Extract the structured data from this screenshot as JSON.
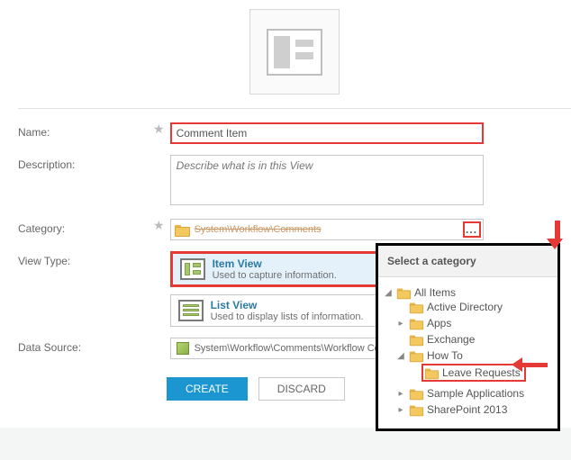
{
  "labels": {
    "name": "Name:",
    "description": "Description:",
    "category": "Category:",
    "viewtype": "View Type:",
    "datasource": "Data Source:"
  },
  "name_value": "Comment Item",
  "description_placeholder": "Describe what is in this View",
  "category_value": "System\\Workflow\\Comments",
  "ellipsis": "...",
  "view_types": {
    "item": {
      "title": "Item View",
      "sub": "Used to capture information."
    },
    "list": {
      "title": "List View",
      "sub": "Used to display lists of information."
    }
  },
  "datasource_value": "System\\Workflow\\Comments\\Workflow Co",
  "buttons": {
    "create": "CREATE",
    "discard": "DISCARD"
  },
  "popup": {
    "title": "Select a category",
    "tree": {
      "root": "All Items",
      "children": [
        {
          "label": "Active Directory",
          "expandable": false
        },
        {
          "label": "Apps",
          "expandable": true
        },
        {
          "label": "Exchange",
          "expandable": false
        },
        {
          "label": "How To",
          "expandable": true,
          "expanded": true,
          "children": [
            {
              "label": "Leave Requests",
              "highlight": true
            }
          ]
        },
        {
          "label": "Sample Applications",
          "expandable": true
        },
        {
          "label": "SharePoint 2013",
          "expandable": true
        }
      ]
    }
  }
}
